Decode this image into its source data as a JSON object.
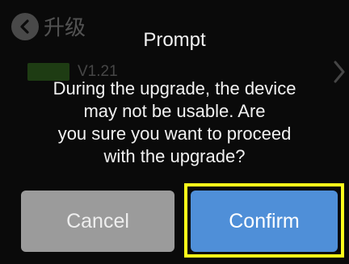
{
  "background_page": {
    "title": "升级",
    "version": "V1.21"
  },
  "dialog": {
    "title": "Prompt",
    "message": "During the upgrade, the device\nmay not be usable. Are\nyou sure you want to proceed\nwith the upgrade?",
    "cancel_label": "Cancel",
    "confirm_label": "Confirm"
  },
  "colors": {
    "cancel_bg": "#9b9b9b",
    "confirm_bg": "#4f8fd8",
    "highlight": "#ffff1a",
    "version_tag": "#4caf2a"
  },
  "icons": {
    "back": "back-arrow-icon",
    "chevron": "chevron-right-icon"
  }
}
